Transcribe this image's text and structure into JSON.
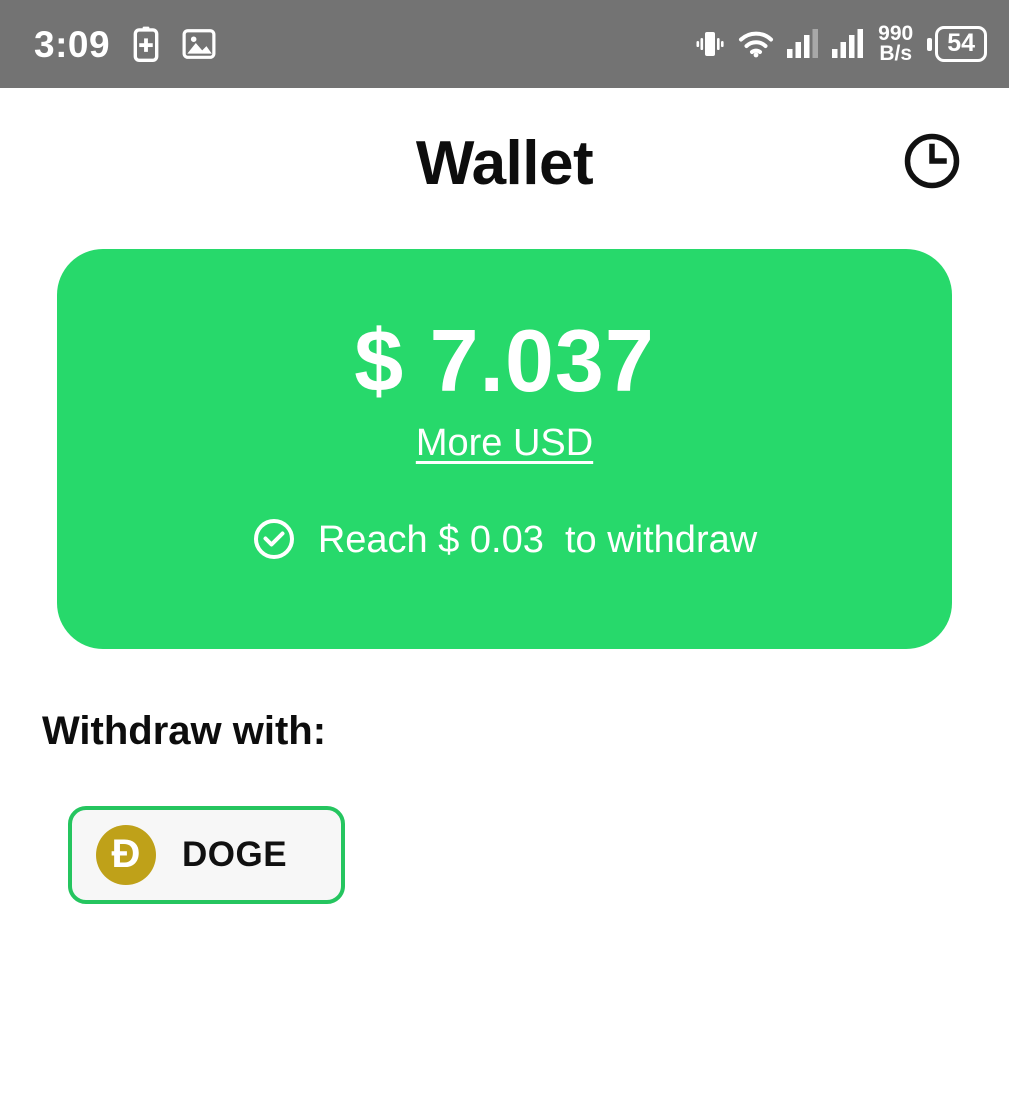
{
  "status_bar": {
    "clock": "3:09",
    "left_icons": [
      "battery-plus-icon",
      "image-icon"
    ],
    "right_icons": [
      "vibrate-icon",
      "wifi-icon",
      "signal-1-icon",
      "signal-2-icon"
    ],
    "network_speed_value": "990",
    "network_speed_unit": "B/s",
    "battery_level": "54",
    "background_color": "#737373"
  },
  "header": {
    "title": "Wallet",
    "history_icon": "clock-history-icon"
  },
  "balance_card": {
    "amount": "$ 7.037",
    "more_link": "More USD",
    "status_icon": "check-circle-icon",
    "status_text": "Reach $ 0.03  to withdraw",
    "background_color": "#27d96b"
  },
  "withdraw": {
    "label": "Withdraw with:",
    "methods": [
      {
        "name": "DOGE",
        "coin_symbol": "Ð",
        "coin_color": "#bfa119",
        "border_color": "#25c55f"
      }
    ]
  }
}
